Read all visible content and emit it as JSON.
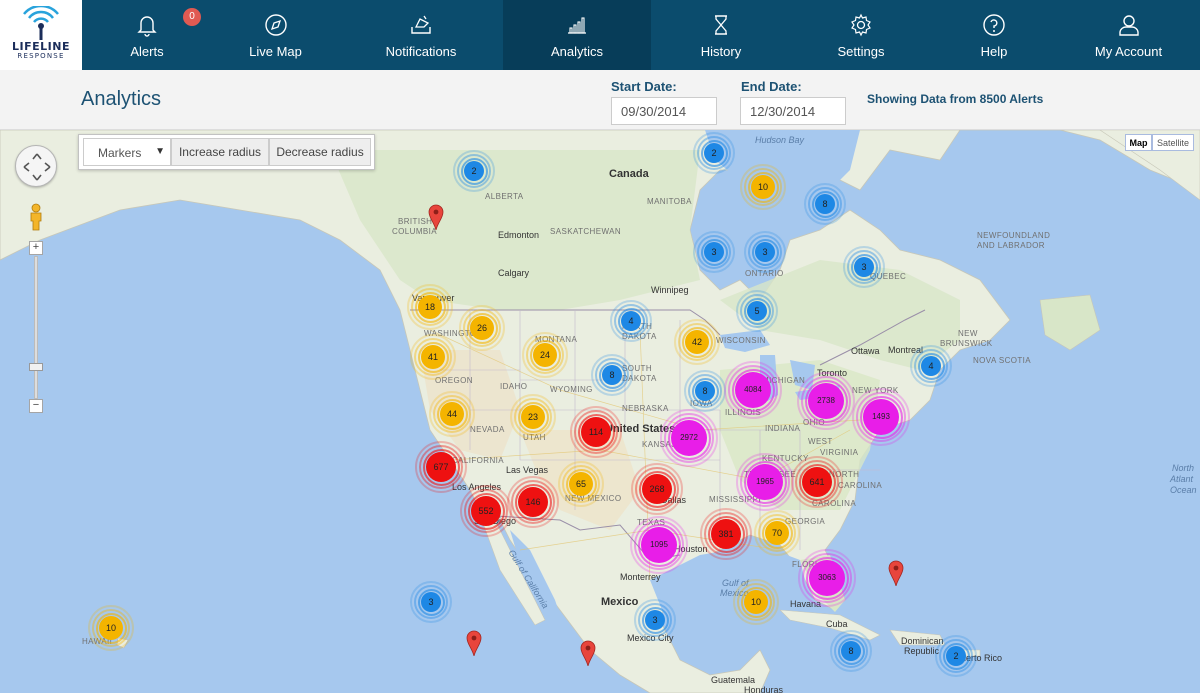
{
  "app": {
    "logo_name": "LIFELINE",
    "logo_sub": "RESPONSE"
  },
  "nav": {
    "items": [
      {
        "label": "Alerts",
        "icon": "bell-icon",
        "badge": "0"
      },
      {
        "label": "Live Map",
        "icon": "compass-icon"
      },
      {
        "label": "Notifications",
        "icon": "megaphone-icon"
      },
      {
        "label": "Analytics",
        "icon": "bar-chart-icon",
        "active": true
      },
      {
        "label": "History",
        "icon": "hourglass-icon"
      },
      {
        "label": "Settings",
        "icon": "gear-icon"
      },
      {
        "label": "Help",
        "icon": "help-icon"
      },
      {
        "label": "My Account",
        "icon": "user-icon"
      }
    ]
  },
  "header": {
    "title": "Analytics",
    "start_label": "Start Date:",
    "start_value": "09/30/2014",
    "end_label": "End Date:",
    "end_value": "12/30/2014",
    "showing": "Showing Data from 8500 Alerts"
  },
  "map_controls": {
    "layer_selected": "Markers",
    "increase_label": "Increase radius",
    "decrease_label": "Decrease radius",
    "map_type_map": "Map",
    "map_type_satellite": "Satellite",
    "zoom_in": "+",
    "zoom_out": "−"
  },
  "map": {
    "labels": {
      "canada": "Canada",
      "united_states": "United States",
      "mexico": "Mexico",
      "hudson_bay": "Hudson Bay",
      "gulf_mexico_1": "Gulf of",
      "gulf_mexico_2": "Mexico",
      "gulf_california": "Gulf of California",
      "north_atlantic_1": "North",
      "north_atlantic_2": "Atlant",
      "north_atlantic_3": "Ocean",
      "alberta": "ALBERTA",
      "british_columbia_1": "BRITISH",
      "british_columbia_2": "COLUMBIA",
      "saskatchewan": "SASKATCHEWAN",
      "manitoba": "MANITOBA",
      "ontario": "ONTARIO",
      "quebec": "QUEBEC",
      "newfoundland_1": "NEWFOUNDLAND",
      "newfoundland_2": "AND LABRADOR",
      "new_brunswick_1": "NEW",
      "new_brunswick_2": "BRUNSWICK",
      "nova_scotia": "NOVA SCOTIA",
      "washington": "WASHINGTON",
      "oregon": "OREGON",
      "montana": "MONTANA",
      "idaho": "IDAHO",
      "wyoming": "WYOMING",
      "nevada": "NEVADA",
      "utah": "UTAH",
      "california": "CALIFORNIA",
      "north_dakota_1": "NORTH",
      "north_dakota_2": "DAKOTA",
      "south_dakota_1": "SOUTH",
      "south_dakota_2": "DAKOTA",
      "nebraska": "NEBRASKA",
      "kansas": "KANSAS",
      "iowa": "IOWA",
      "wisconsin": "WISCONSIN",
      "michigan": "MICHIGAN",
      "illinois": "ILLINOIS",
      "indiana": "INDIANA",
      "ohio": "OHIO",
      "new_york": "NEW YORK",
      "west_virginia": "WEST",
      "virginia": "VIRGINIA",
      "kentucky": "KENTUCKY",
      "tennessee": "TENNESSEE",
      "north_carolina_1": "NORTH",
      "north_carolina_2": "CAROLINA",
      "south_carolina": "CAROLINA",
      "georgia": "GEORGIA",
      "mississippi": "MISSISSIPPI",
      "texas": "TEXAS",
      "new_mexico": "NEW MEXICO",
      "florida": "FLORI",
      "hawaii": "HAWAII",
      "edmonton": "Edmonton",
      "calgary": "Calgary",
      "vancouver": "Vancouver",
      "winnipeg": "Winnipeg",
      "toronto": "Toronto",
      "ottawa": "Ottawa",
      "montreal": "Montreal",
      "las_vegas": "Las Vegas",
      "los_angeles": "Los Angeles",
      "san_diego": "San Diego",
      "dallas": "Dallas",
      "houston": "Houston",
      "mexico_city": "Mexico City",
      "monterrey": "Monterrey",
      "havana": "Havana",
      "cuba": "Cuba",
      "dominican_1": "Dominican",
      "dominican_2": "Republic",
      "puerto_rico": "Puerto Rico",
      "guatemala": "Guatemala",
      "honduras": "Honduras"
    },
    "clusters": [
      {
        "count": "2",
        "color": "#1e88e5"
      },
      {
        "count": "2",
        "color": "#1e88e5"
      },
      {
        "count": "10",
        "color": "#f4b400"
      },
      {
        "count": "8",
        "color": "#1e88e5"
      },
      {
        "count": "3",
        "color": "#1e88e5"
      },
      {
        "count": "3",
        "color": "#1e88e5"
      },
      {
        "count": "3",
        "color": "#1e88e5"
      },
      {
        "count": "18",
        "color": "#f4b400"
      },
      {
        "count": "26",
        "color": "#f4b400"
      },
      {
        "count": "4",
        "color": "#1e88e5"
      },
      {
        "count": "5",
        "color": "#1e88e5"
      },
      {
        "count": "42",
        "color": "#f4b400"
      },
      {
        "count": "41",
        "color": "#f4b400"
      },
      {
        "count": "24",
        "color": "#f4b400"
      },
      {
        "count": "8",
        "color": "#1e88e5"
      },
      {
        "count": "8",
        "color": "#1e88e5"
      },
      {
        "count": "4084",
        "color": "#e81ee8"
      },
      {
        "count": "2738",
        "color": "#e81ee8"
      },
      {
        "count": "4",
        "color": "#1e88e5"
      },
      {
        "count": "1493",
        "color": "#e81ee8"
      },
      {
        "count": "44",
        "color": "#f4b400"
      },
      {
        "count": "23",
        "color": "#f4b400"
      },
      {
        "count": "114",
        "color": "#ee1111"
      },
      {
        "count": "2972",
        "color": "#e81ee8"
      },
      {
        "count": "677",
        "color": "#ee1111"
      },
      {
        "count": "65",
        "color": "#f4b400"
      },
      {
        "count": "1965",
        "color": "#e81ee8"
      },
      {
        "count": "641",
        "color": "#ee1111"
      },
      {
        "count": "268",
        "color": "#ee1111"
      },
      {
        "count": "146",
        "color": "#ee1111"
      },
      {
        "count": "552",
        "color": "#ee1111"
      },
      {
        "count": "381",
        "color": "#ee1111"
      },
      {
        "count": "70",
        "color": "#f4b400"
      },
      {
        "count": "1095",
        "color": "#e81ee8"
      },
      {
        "count": "3063",
        "color": "#e81ee8"
      },
      {
        "count": "3",
        "color": "#1e88e5"
      },
      {
        "count": "3",
        "color": "#1e88e5"
      },
      {
        "count": "10",
        "color": "#f4b400"
      },
      {
        "count": "10",
        "color": "#f4b400"
      },
      {
        "count": "8",
        "color": "#1e88e5"
      },
      {
        "count": "2",
        "color": "#1e88e5"
      }
    ]
  }
}
